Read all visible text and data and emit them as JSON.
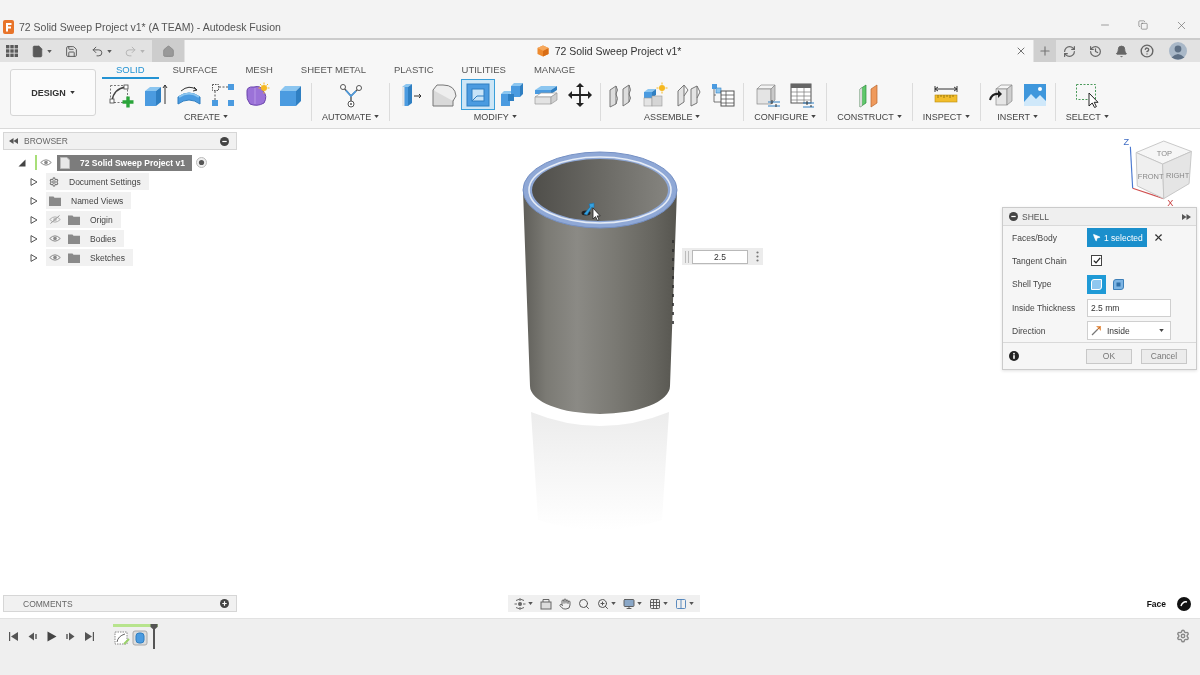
{
  "window": {
    "title": "72 Solid Sweep Project v1* (A TEAM) - Autodesk Fusion"
  },
  "quick_access": [
    {
      "kind": "apps",
      "disabled": false
    },
    {
      "kind": "file",
      "disabled": false
    },
    {
      "kind": "save",
      "disabled": false
    },
    {
      "kind": "undo",
      "disabled": false
    },
    {
      "kind": "redo",
      "disabled": true
    },
    {
      "kind": "home",
      "disabled": false
    }
  ],
  "document_tab": {
    "title": "72 Solid Sweep Project v1*"
  },
  "workspace": {
    "label": "DESIGN"
  },
  "toolbar_tabs": [
    {
      "label": "SOLID",
      "selected": true
    },
    {
      "label": "SURFACE",
      "selected": false
    },
    {
      "label": "MESH",
      "selected": false
    },
    {
      "label": "SHEET METAL",
      "selected": false
    },
    {
      "label": "PLASTIC",
      "selected": false
    },
    {
      "label": "UTILITIES",
      "selected": false
    },
    {
      "label": "MANAGE",
      "selected": false
    }
  ],
  "tool_groups": [
    {
      "label": "CREATE",
      "tools": [
        {
          "kind": "sketch",
          "selected": false
        },
        {
          "kind": "extrude",
          "selected": false
        },
        {
          "kind": "revolve",
          "selected": false
        },
        {
          "kind": "pattern",
          "selected": false
        },
        {
          "kind": "form",
          "selected": false
        },
        {
          "kind": "box",
          "selected": false
        }
      ]
    },
    {
      "label": "AUTOMATE",
      "tools": [
        {
          "kind": "automate",
          "selected": false
        }
      ]
    },
    {
      "label": "MODIFY",
      "tools": [
        {
          "kind": "press",
          "selected": false
        },
        {
          "kind": "fillet",
          "selected": false
        },
        {
          "kind": "shell",
          "selected": true
        },
        {
          "kind": "combine",
          "selected": false
        },
        {
          "kind": "layers",
          "selected": false
        },
        {
          "kind": "move",
          "selected": false
        }
      ]
    },
    {
      "label": "ASSEMBLE",
      "tools": [
        {
          "kind": "joint",
          "selected": false
        },
        {
          "kind": "component",
          "selected": false
        },
        {
          "kind": "motion",
          "selected": false
        },
        {
          "kind": "bom",
          "selected": false
        }
      ]
    },
    {
      "label": "CONFIGURE",
      "tools": [
        {
          "kind": "parameters",
          "selected": false
        },
        {
          "kind": "configtable",
          "selected": false
        }
      ]
    },
    {
      "label": "CONSTRUCT",
      "tools": [
        {
          "kind": "plane",
          "selected": false
        }
      ]
    },
    {
      "label": "INSPECT",
      "tools": [
        {
          "kind": "measure",
          "selected": false
        }
      ]
    },
    {
      "label": "INSERT",
      "tools": [
        {
          "kind": "insert",
          "selected": false
        },
        {
          "kind": "image",
          "selected": false
        }
      ]
    },
    {
      "label": "SELECT",
      "tools": [
        {
          "kind": "select",
          "selected": false
        }
      ]
    }
  ],
  "browser": {
    "title": "BROWSER",
    "root": {
      "label": "72 Solid Sweep Project v1",
      "selected": true,
      "expanded": true,
      "visible": true,
      "children": [
        {
          "label": "Document Settings",
          "kind": "settings",
          "selected": false,
          "expanded": false
        },
        {
          "label": "Named Views",
          "kind": "folder",
          "selected": false,
          "expanded": false
        },
        {
          "label": "Origin",
          "kind": "folder",
          "selected": false,
          "expanded": false,
          "visible": false
        },
        {
          "label": "Bodies",
          "kind": "folder",
          "selected": false,
          "expanded": false,
          "visible": true
        },
        {
          "label": "Sketches",
          "kind": "folder",
          "selected": false,
          "expanded": false,
          "visible": true
        }
      ]
    }
  },
  "view_cube": {
    "axes": [
      "Z",
      "X"
    ],
    "faces": [
      "TOP",
      "FRONT",
      "RIGHT"
    ]
  },
  "dimension_input": {
    "value": "2.5"
  },
  "shell_dialog": {
    "title": "SHELL",
    "rows": [
      {
        "kind": "selection",
        "label": "Faces/Body",
        "value": "1 selected"
      },
      {
        "kind": "checkbox",
        "label": "Tangent Chain",
        "checked": true
      },
      {
        "kind": "options",
        "label": "Shell Type",
        "options": [
          {
            "selected": true
          },
          {
            "selected": false
          }
        ]
      },
      {
        "kind": "input",
        "label": "Inside Thickness",
        "value": "2.5 mm"
      },
      {
        "kind": "dropdown",
        "label": "Direction",
        "value": "Inside"
      }
    ],
    "buttons": [
      "OK",
      "Cancel"
    ]
  },
  "comments": {
    "title": "COMMENTS"
  },
  "selection_filter": {
    "label": "Face"
  },
  "timeline": {
    "features": [
      {
        "kind": "sketch"
      },
      {
        "kind": "body"
      }
    ]
  }
}
